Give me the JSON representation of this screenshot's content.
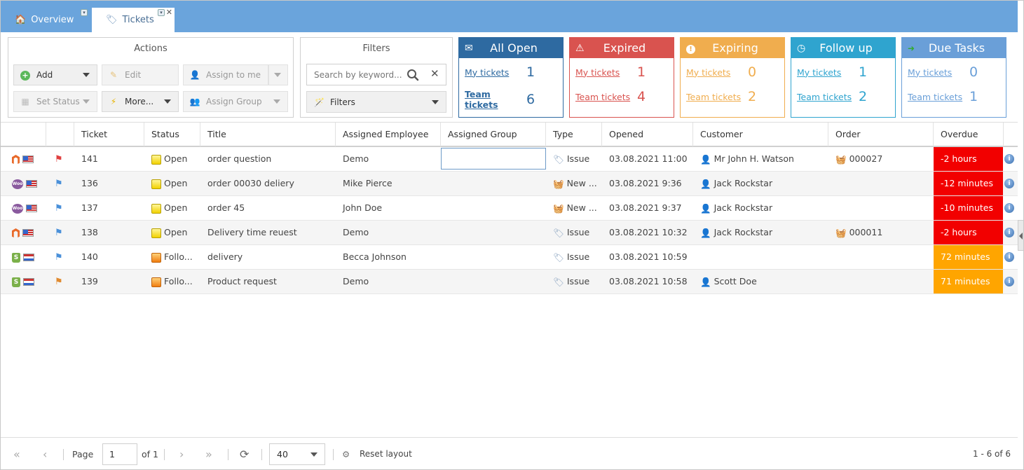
{
  "tabs": [
    {
      "label": "Overview"
    },
    {
      "label": "Tickets"
    }
  ],
  "actions": {
    "title": "Actions",
    "add": "Add",
    "edit": "Edit",
    "assign_to_me": "Assign to me",
    "set_status": "Set Status",
    "more": "More...",
    "assign_group": "Assign Group"
  },
  "filters": {
    "title": "Filters",
    "search_placeholder": "Search by keyword...",
    "filters_button": "Filters"
  },
  "tiles": [
    {
      "title": "All Open",
      "my_label": "My tickets",
      "my_count": "1",
      "team_label": "Team tickets",
      "team_count": "6",
      "color": "#2e6aa1"
    },
    {
      "title": "Expired",
      "my_label": "My tickets",
      "my_count": "1",
      "team_label": "Team tickets",
      "team_count": "4",
      "color": "#d9534f"
    },
    {
      "title": "Expiring",
      "my_label": "My tickets",
      "my_count": "0",
      "team_label": "Team tickets",
      "team_count": "2",
      "color": "#f0ad4e"
    },
    {
      "title": "Follow up",
      "my_label": "My tickets",
      "my_count": "1",
      "team_label": "Team tickets",
      "team_count": "2",
      "color": "#2fa4cf"
    },
    {
      "title": "Due Tasks",
      "my_label": "My tickets",
      "my_count": "0",
      "team_label": "Team tickets",
      "team_count": "1",
      "color": "#6a9fd8"
    }
  ],
  "columns": [
    "Ticket",
    "Status",
    "Title",
    "Assigned Employee",
    "Assigned Group",
    "Type",
    "Opened",
    "Customer",
    "Order",
    "Overdue"
  ],
  "rows": [
    {
      "shop": "magento",
      "flag": "us",
      "prio": "red",
      "ticket": "141",
      "status": "Open",
      "status_kind": "open",
      "title": "order question",
      "employee": "Demo",
      "group": "",
      "type_icon": "tag",
      "type": "Issue",
      "opened": "03.08.2021 11:00",
      "customer": "Mr John H. Watson",
      "order": "000027",
      "overdue": "-2 hours",
      "overdue_kind": "red"
    },
    {
      "shop": "woo",
      "flag": "us",
      "prio": "blue",
      "ticket": "136",
      "status": "Open",
      "status_kind": "open",
      "title": "order 00030 deliery",
      "employee": "Mike Pierce",
      "group": "",
      "type_icon": "basket",
      "type": "New ...",
      "opened": "03.08.2021 9:36",
      "customer": "Jack Rockstar",
      "order": "",
      "overdue": "-12 minutes",
      "overdue_kind": "red"
    },
    {
      "shop": "woo",
      "flag": "us",
      "prio": "blue",
      "ticket": "137",
      "status": "Open",
      "status_kind": "open",
      "title": "order 45",
      "employee": "John Doe",
      "group": "",
      "type_icon": "basket",
      "type": "New ...",
      "opened": "03.08.2021 9:37",
      "customer": "Jack Rockstar",
      "order": "",
      "overdue": "-10 minutes",
      "overdue_kind": "red"
    },
    {
      "shop": "magento",
      "flag": "us",
      "prio": "blue",
      "ticket": "138",
      "status": "Open",
      "status_kind": "open",
      "title": "Delivery time reuest",
      "employee": "Demo",
      "group": "",
      "type_icon": "tag",
      "type": "Issue",
      "opened": "03.08.2021 10:32",
      "customer": "Jack Rockstar",
      "order": "000011",
      "overdue": "-2 hours",
      "overdue_kind": "red"
    },
    {
      "shop": "shopify",
      "flag": "nl",
      "prio": "blue",
      "ticket": "140",
      "status": "Follo...",
      "status_kind": "follow",
      "title": "delivery",
      "employee": "Becca Johnson",
      "group": "",
      "type_icon": "tag",
      "type": "Issue",
      "opened": "03.08.2021 10:59",
      "customer": "",
      "order": "",
      "overdue": "72 minutes",
      "overdue_kind": "orange"
    },
    {
      "shop": "shopify",
      "flag": "nl",
      "prio": "orange",
      "ticket": "139",
      "status": "Follo...",
      "status_kind": "follow",
      "title": "Product request",
      "employee": "Demo",
      "group": "",
      "type_icon": "tag",
      "type": "Issue",
      "opened": "03.08.2021 10:58",
      "customer": "Scott Doe",
      "order": "",
      "overdue": "71 minutes",
      "overdue_kind": "orange"
    }
  ],
  "pager": {
    "page_label": "Page",
    "page_value": "1",
    "of_label": "of 1",
    "page_size": "40",
    "reset_layout": "Reset layout",
    "summary": "1 - 6 of 6"
  }
}
